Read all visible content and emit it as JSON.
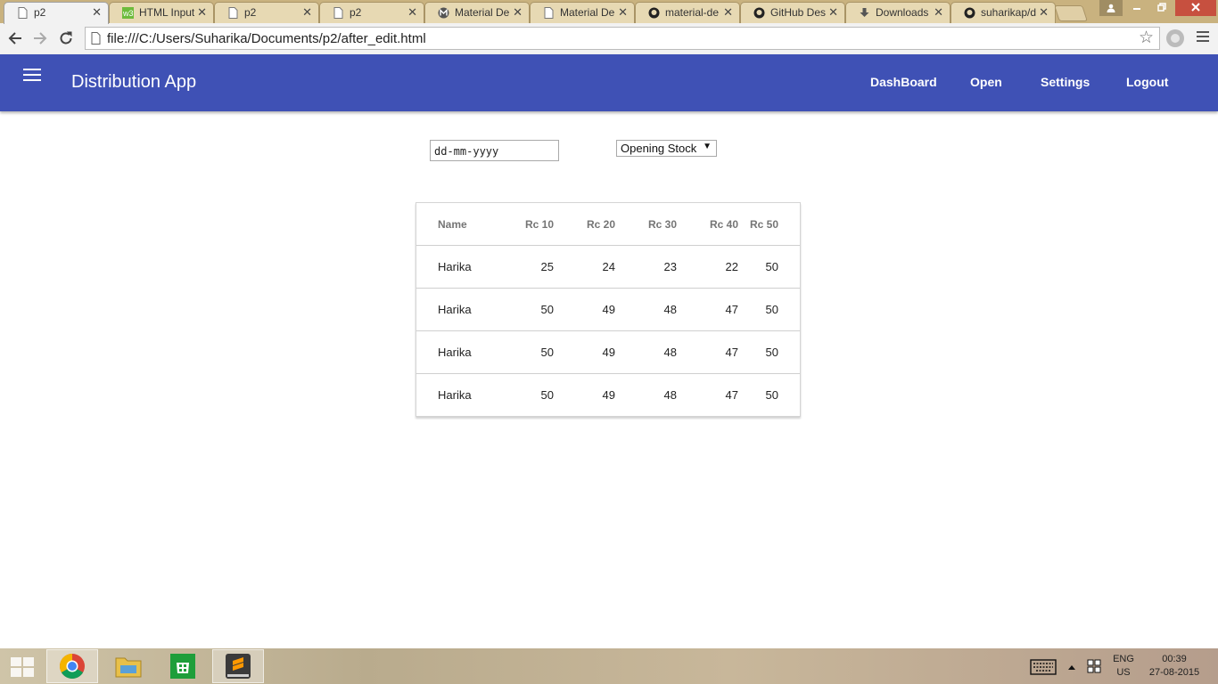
{
  "browser": {
    "tabs": [
      {
        "title": "p2",
        "icon": "page-icon"
      },
      {
        "title": "HTML Input",
        "icon": "w3schools-icon"
      },
      {
        "title": "p2",
        "icon": "page-icon"
      },
      {
        "title": "p2",
        "icon": "page-icon"
      },
      {
        "title": "Material De",
        "icon": "material-icon"
      },
      {
        "title": "Material De",
        "icon": "page-icon"
      },
      {
        "title": "material-de",
        "icon": "github-icon"
      },
      {
        "title": "GitHub Des",
        "icon": "github-icon"
      },
      {
        "title": "Downloads",
        "icon": "download-icon"
      },
      {
        "title": "suharikap/d",
        "icon": "github-icon"
      }
    ],
    "url": "file:///C:/Users/Suharika/Documents/p2/after_edit.html"
  },
  "app": {
    "title": "Distribution App",
    "nav": [
      "DashBoard",
      "Open",
      "Settings",
      "Logout"
    ]
  },
  "filters": {
    "date_placeholder": "dd-mm-yyyy",
    "stock_type": "Opening Stock"
  },
  "table": {
    "headers": [
      "Name",
      "Rc 10",
      "Rc 20",
      "Rc 30",
      "Rc 40",
      "Rc 50"
    ],
    "rows": [
      [
        "Harika",
        "25",
        "24",
        "23",
        "22",
        "50"
      ],
      [
        "Harika",
        "50",
        "49",
        "48",
        "47",
        "50"
      ],
      [
        "Harika",
        "50",
        "49",
        "48",
        "47",
        "50"
      ],
      [
        "Harika",
        "50",
        "49",
        "48",
        "47",
        "50"
      ]
    ]
  },
  "taskbar": {
    "language": "ENG",
    "region": "US",
    "time": "00:39",
    "date": "27-08-2015"
  },
  "colors": {
    "appbar": "#3f51b5"
  }
}
